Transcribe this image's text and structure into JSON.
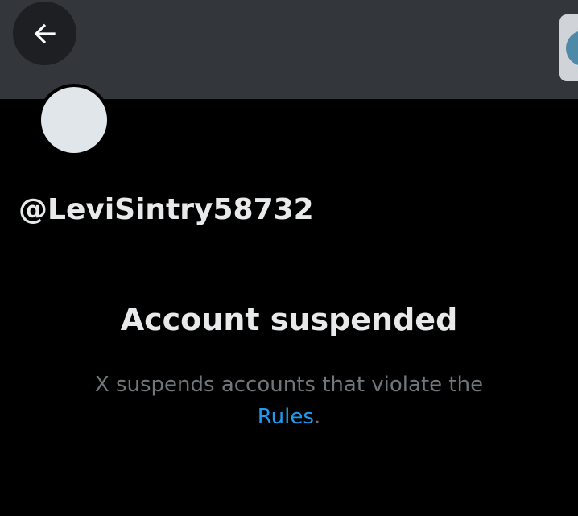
{
  "header": {
    "back_icon": "arrow-left-icon",
    "overlay_icon": "globe-icon"
  },
  "profile": {
    "handle": "@LeviSintry58732"
  },
  "notice": {
    "title": "Account suspended",
    "description": "X suspends accounts that violate the",
    "link_label": "Rules",
    "trailing": "."
  },
  "colors": {
    "background": "#000000",
    "banner": "#33363a",
    "text_primary": "#e7e9ea",
    "text_secondary": "#71767b",
    "link": "#1d9bf0"
  }
}
